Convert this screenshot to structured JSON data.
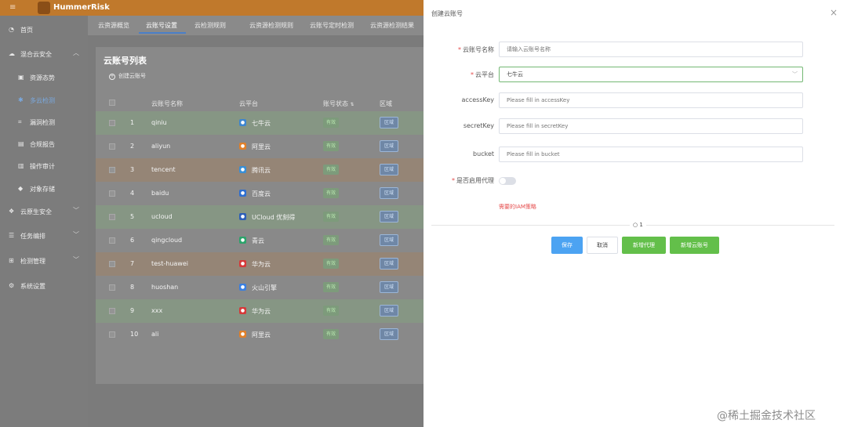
{
  "app": {
    "brand": "HummerRisk",
    "menu_icon": "hamburger-icon"
  },
  "sidebar": {
    "items": [
      {
        "label": "首页",
        "icon": "dashboard-icon",
        "level": "top"
      },
      {
        "label": "混合云安全",
        "icon": "cloud-icon",
        "level": "top",
        "expanded": true
      },
      {
        "label": "资源态势",
        "icon": "grid-icon",
        "level": "sub"
      },
      {
        "label": "多云检测",
        "icon": "bug-icon",
        "level": "sub",
        "active": true
      },
      {
        "label": "漏洞检测",
        "icon": "scan-icon",
        "level": "sub"
      },
      {
        "label": "合规报告",
        "icon": "report-icon",
        "level": "sub"
      },
      {
        "label": "操作审计",
        "icon": "audit-icon",
        "level": "sub"
      },
      {
        "label": "对象存储",
        "icon": "storage-icon",
        "level": "sub"
      },
      {
        "label": "云原生安全",
        "icon": "cube-icon",
        "level": "top"
      },
      {
        "label": "任务编排",
        "icon": "list-icon",
        "level": "top"
      },
      {
        "label": "检测管理",
        "icon": "manage-icon",
        "level": "top"
      },
      {
        "label": "系统设置",
        "icon": "gear-icon",
        "level": "top"
      }
    ]
  },
  "tabs": [
    {
      "label": "云资源概览"
    },
    {
      "label": "云账号设置",
      "active": true
    },
    {
      "label": "云检测规则"
    },
    {
      "label": "云资源检测规则"
    },
    {
      "label": "云账号定时检测"
    },
    {
      "label": "云资源检测结果"
    }
  ],
  "list": {
    "title": "云账号列表",
    "create_label": "创建云账号",
    "columns": [
      "云账号名称",
      "云平台",
      "账号状态",
      "区域"
    ],
    "sort_indicator": "⇅",
    "rows": [
      {
        "index": "1",
        "name": "qiniu",
        "platform": "七牛云",
        "status": "有效",
        "region": "区域",
        "tone": "green",
        "icon": "qiniu-icon",
        "icon_color": "#3e86d0"
      },
      {
        "index": "2",
        "name": "aliyun",
        "platform": "阿里云",
        "status": "有效",
        "region": "区域",
        "tone": "plain",
        "icon": "aliyun-icon",
        "icon_color": "#e0802a"
      },
      {
        "index": "3",
        "name": "tencent",
        "platform": "腾讯云",
        "status": "有效",
        "region": "区域",
        "tone": "orange",
        "icon": "tencent-icon",
        "icon_color": "#3a8fd6"
      },
      {
        "index": "4",
        "name": "baidu",
        "platform": "百度云",
        "status": "有效",
        "region": "区域",
        "tone": "plain",
        "icon": "baidu-icon",
        "icon_color": "#2e6fd1"
      },
      {
        "index": "5",
        "name": "ucloud",
        "platform": "UCloud 优刻得",
        "status": "有效",
        "region": "区域",
        "tone": "green",
        "icon": "ucloud-icon",
        "icon_color": "#2e5fb8"
      },
      {
        "index": "6",
        "name": "qingcloud",
        "platform": "青云",
        "status": "有效",
        "region": "区域",
        "tone": "plain",
        "icon": "qingcloud-icon",
        "icon_color": "#2ca36b"
      },
      {
        "index": "7",
        "name": "test-huawei",
        "platform": "华为云",
        "status": "有效",
        "region": "区域",
        "tone": "orange",
        "icon": "huawei-icon",
        "icon_color": "#d63a3a"
      },
      {
        "index": "8",
        "name": "huoshan",
        "platform": "火山引擎",
        "status": "有效",
        "region": "区域",
        "tone": "plain",
        "icon": "volcengine-icon",
        "icon_color": "#3a7fe0"
      },
      {
        "index": "9",
        "name": "xxx",
        "platform": "华为云",
        "status": "有效",
        "region": "区域",
        "tone": "green",
        "icon": "huawei-icon",
        "icon_color": "#d63a3a"
      },
      {
        "index": "10",
        "name": "ali",
        "platform": "阿里云",
        "status": "有效",
        "region": "区域",
        "tone": "plain",
        "icon": "aliyun-icon",
        "icon_color": "#e0802a"
      }
    ]
  },
  "drawer": {
    "title": "创建云账号",
    "close_icon": "close-icon",
    "fields": {
      "name": {
        "label": "云账号名称",
        "required": true,
        "placeholder": "请输入云账号名称",
        "value": ""
      },
      "platform": {
        "label": "云平台",
        "required": true,
        "value": "七牛云"
      },
      "access_key": {
        "label": "accessKey",
        "placeholder": "Please fill in accessKey",
        "value": ""
      },
      "secret_key": {
        "label": "secretKey",
        "placeholder": "Please fill in secretKey",
        "value": ""
      },
      "bucket": {
        "label": "bucket",
        "placeholder": "Please fill in bucket",
        "value": ""
      },
      "proxy": {
        "label": "是否启用代理",
        "required": true,
        "enabled": false
      }
    },
    "iam_link": "需要的IAM策略",
    "page_indicator": "1",
    "buttons": {
      "save": "保存",
      "cancel": "取消",
      "add_proxy": "新增代理",
      "add_account": "新增云账号"
    }
  },
  "watermark": "@稀土掘金技术社区",
  "colors": {
    "primary": "#4ca3f2",
    "success": "#63bf4a",
    "danger": "#e54b4b",
    "brand_bar": "#c0792c"
  }
}
